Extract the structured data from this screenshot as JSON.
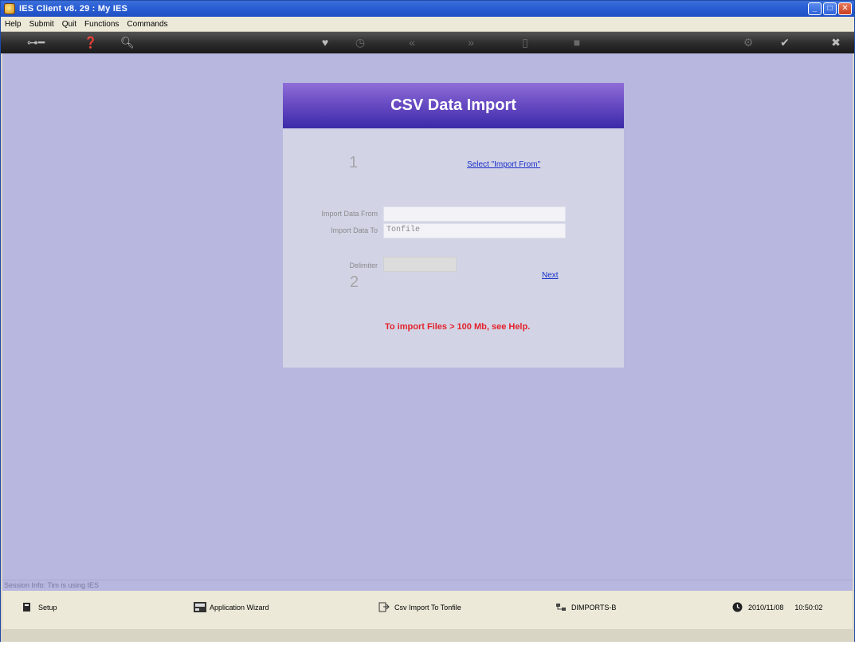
{
  "window": {
    "title": "IES Client v8. 29 : My IES"
  },
  "menu": [
    "Help",
    "Submit",
    "Quit",
    "Functions",
    "Commands"
  ],
  "toolbar_icons": {
    "key": "key-icon",
    "help": "help-icon",
    "search": "search-icon",
    "heart": "heart-icon",
    "clock": "clock-icon",
    "prev": "prev-icon",
    "next": "next-icon",
    "doc": "doc-icon",
    "stop": "stop-icon",
    "gear": "gear-icon",
    "check": "check-icon",
    "close": "close-icon"
  },
  "panel": {
    "title": "CSV Data Import",
    "step1": "1",
    "select_link": "Select \"Import From\"",
    "import_from_label": "Import Data From",
    "import_from_value": "",
    "import_to_label": "Import Data To",
    "import_to_value": "Tonfile",
    "delimiter_label": "Delimiter",
    "delimiter_value": "",
    "step2": "2",
    "next_link": "Next",
    "warning": "To import Files > 100 Mb, see Help."
  },
  "session": {
    "text": "Session Info: Tim is using IES"
  },
  "status": {
    "setup": "Setup",
    "wizard": "Application Wizard",
    "csv": "Csv Import To Tonfile",
    "dimports": "DIMPORTS-B",
    "date": "2010/11/08",
    "time": "10:50:02"
  },
  "colors": {
    "main_bg": "#b8b7e0",
    "header_top": "#8e6ed6",
    "header_bottom": "#3b2aa8",
    "warning": "#e4222a"
  }
}
